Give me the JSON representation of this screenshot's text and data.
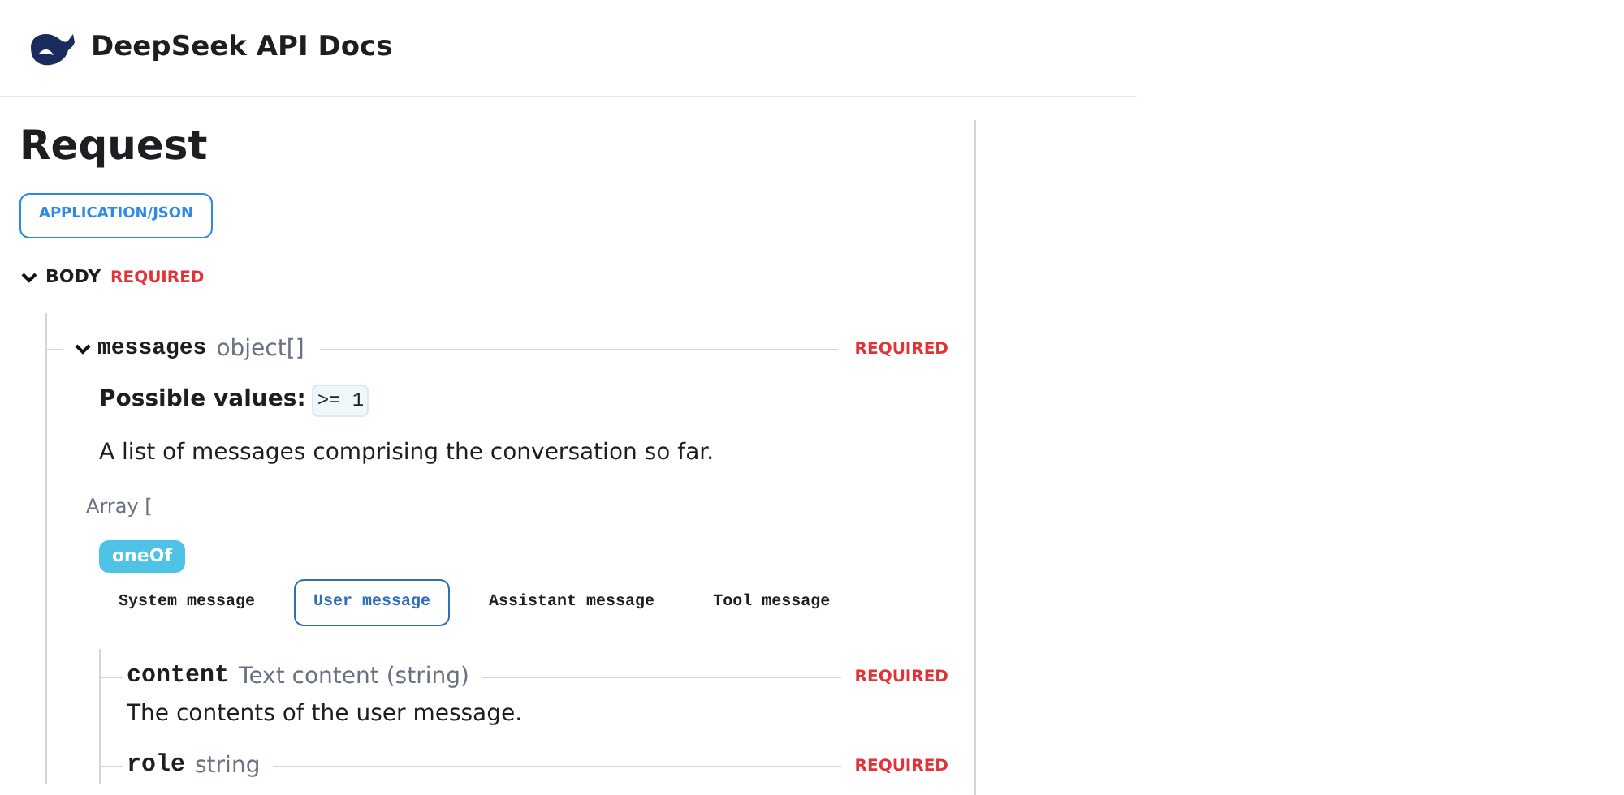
{
  "header": {
    "title": "DeepSeek API Docs"
  },
  "request": {
    "title": "Request",
    "content_type": "APPLICATION/JSON",
    "body": {
      "label": "BODY",
      "required": "REQUIRED",
      "expanded": true
    }
  },
  "messages": {
    "name": "messages",
    "type": "object[]",
    "required": "REQUIRED",
    "expanded": true,
    "possible_label": "Possible values:",
    "possible_value": ">= 1",
    "description": "A list of messages comprising the conversation so far.",
    "array_open": "Array [",
    "one_of": "oneOf",
    "tabs": [
      {
        "label": "System message",
        "selected": false
      },
      {
        "label": "User message",
        "selected": true
      },
      {
        "label": "Assistant message",
        "selected": false
      },
      {
        "label": "Tool message",
        "selected": false
      }
    ],
    "fields": [
      {
        "name": "content",
        "type": "Text content (string)",
        "required": "REQUIRED",
        "description": "The contents of the user message."
      },
      {
        "name": "role",
        "type": "string",
        "required": "REQUIRED"
      }
    ]
  }
}
